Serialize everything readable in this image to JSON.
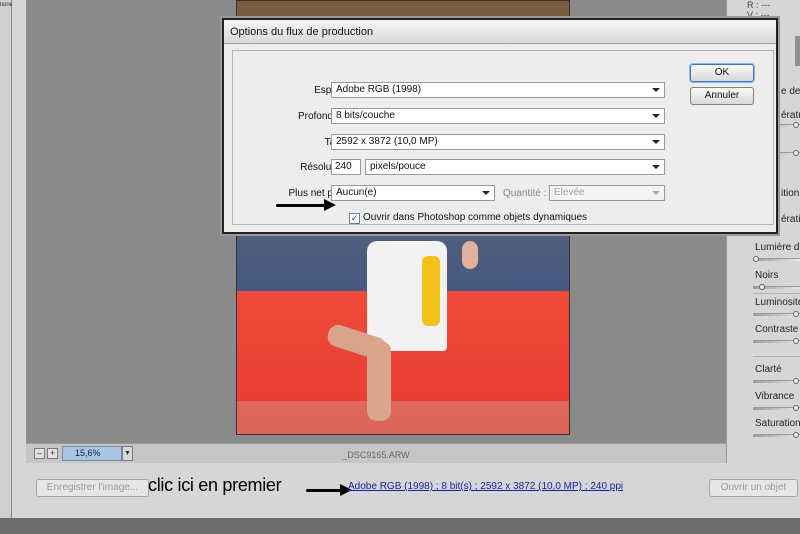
{
  "left_strip": {
    "label": "tione"
  },
  "preview": {
    "zoom_minus": "–",
    "zoom_plus": "+",
    "zoom_value": "15,6%",
    "zoom_arrow": "▼",
    "filename": "_DSC9165.ARW"
  },
  "right_panel": {
    "readout": {
      "r": "R :  ---",
      "v": "V :  ---"
    },
    "labels": {
      "balance_partial": "e des",
      "temperature_partial": "ératur",
      "exposition_partial": "ition",
      "recuperation_partial": "ération",
      "lumiere": "Lumière d'ap",
      "noirs": "Noirs",
      "luminosite": "Luminosité",
      "contraste": "Contraste",
      "clarte": "Clarté",
      "vibrance": "Vibrance",
      "saturation": "Saturation"
    }
  },
  "dialog": {
    "title": "Options du flux de production",
    "espace": {
      "label": "Espace :",
      "value": "Adobe RGB (1998)"
    },
    "profondeur": {
      "label": "Profondeur :",
      "value": "8 bits/couche"
    },
    "taille": {
      "label": "Taille :",
      "value": "2592 x 3872 (10,0 MP)"
    },
    "resolution": {
      "label": "Résolution :",
      "value": "240",
      "unit": "pixels/pouce"
    },
    "sharpen": {
      "label": "Plus net pour :",
      "value": "Aucun(e)"
    },
    "quantite": {
      "label": "Quantité :",
      "value": "Elevée"
    },
    "smart_objects": {
      "label": "Ouvrir dans Photoshop comme objets dynamiques",
      "checked": "✓"
    },
    "ok_label": "OK",
    "cancel_label": "Annuler"
  },
  "bottom_bar": {
    "save_image": "Enregistrer l'image...",
    "annotation": "clic ici   en premier",
    "workflow_link": "Adobe RGB (1998) ; 8 bit(s) ; 2592 x 3872 (10,0 MP) ; 240 ppi",
    "open_object": "Ouvrir un objet"
  },
  "colors": {
    "link": "#1a1aa6",
    "zoom_highlight": "#a8c4e6",
    "ok_focus": "#3a78c8"
  }
}
